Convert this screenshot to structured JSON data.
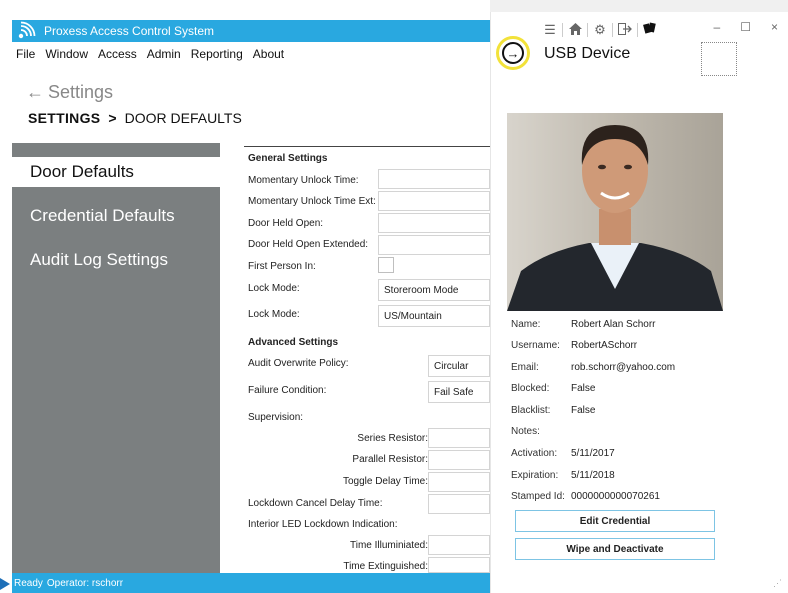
{
  "main_window": {
    "title": "Proxess Access Control System",
    "menu": [
      "File",
      "Window",
      "Access",
      "Admin",
      "Reporting",
      "About"
    ],
    "back_label": "Settings",
    "breadcrumb": {
      "root": "SETTINGS",
      "separator": ">",
      "current": "DOOR DEFAULTS"
    },
    "sidebar": {
      "items": [
        {
          "label": "Door Defaults",
          "active": true
        },
        {
          "label": "Credential Defaults",
          "active": false
        },
        {
          "label": "Audit Log Settings",
          "active": false
        }
      ]
    },
    "general_settings": {
      "heading": "General Settings",
      "momentary_unlock_time": {
        "label": "Momentary Unlock Time:",
        "value": ""
      },
      "momentary_unlock_time_ext": {
        "label": "Momentary Unlock Time Ext:",
        "value": ""
      },
      "door_held_open": {
        "label": "Door Held Open:",
        "value": ""
      },
      "door_held_open_extended": {
        "label": "Door Held Open Extended:",
        "value": ""
      },
      "first_person_in": {
        "label": "First Person In:",
        "checked": false
      },
      "lock_mode": {
        "label": "Lock Mode:",
        "value": "Storeroom Mode"
      },
      "time_zone": {
        "label": "Lock Mode:",
        "value": "US/Mountain"
      }
    },
    "advanced_settings": {
      "heading": "Advanced Settings",
      "audit_overwrite_policy": {
        "label": "Audit Overwrite Policy:",
        "value": "Circular"
      },
      "failure_condition": {
        "label": "Failure Condition:",
        "value": "Fail Safe"
      },
      "supervision": {
        "label": "Supervision:"
      },
      "series_resistor": {
        "label": "Series Resistor:",
        "value": ""
      },
      "parallel_resistor": {
        "label": "Parallel Resistor:",
        "value": ""
      },
      "toggle_delay_time": {
        "label": "Toggle Delay Time:",
        "value": ""
      },
      "lockdown_cancel_delay_time": {
        "label": "Lockdown Cancel Delay Time:",
        "value": ""
      },
      "interior_led_lockdown_indication": {
        "label": "Interior LED Lockdown Indication:"
      },
      "time_illuminated": {
        "label": "Time Illuminiated:",
        "value": ""
      },
      "time_extinguished": {
        "label": "Time Extinguished:",
        "value": ""
      }
    },
    "status": {
      "ready": "Ready",
      "operator": "Operator: rschorr"
    }
  },
  "usb_window": {
    "title": "USB Device",
    "toolbar_icons": [
      "menu-icon",
      "home-icon",
      "gear-icon",
      "exit-icon",
      "cards-icon"
    ],
    "window_controls": {
      "minimize": "–",
      "maximize": "☐",
      "close": "×"
    },
    "credential": {
      "name": {
        "label": "Name:",
        "value": "Robert Alan Schorr"
      },
      "username": {
        "label": "Username:",
        "value": "RobertASchorr"
      },
      "email": {
        "label": "Email:",
        "value": "rob.schorr@yahoo.com"
      },
      "blocked": {
        "label": "Blocked:",
        "value": "False"
      },
      "blacklist": {
        "label": "Blacklist:",
        "value": "False"
      },
      "notes": {
        "label": "Notes:",
        "value": ""
      },
      "activation": {
        "label": "Activation:",
        "value": "5/11/2017"
      },
      "expiration": {
        "label": "Expiration:",
        "value": "5/11/2018"
      },
      "stamped_id": {
        "label": "Stamped Id:",
        "value": "0000000000070261"
      }
    },
    "buttons": {
      "edit": "Edit Credential",
      "wipe": "Wipe and Deactivate"
    }
  },
  "colors": {
    "accent": "#29a8e0",
    "sidebar_bg": "#7b7f80",
    "highlight_ring": "#f2e23a"
  }
}
